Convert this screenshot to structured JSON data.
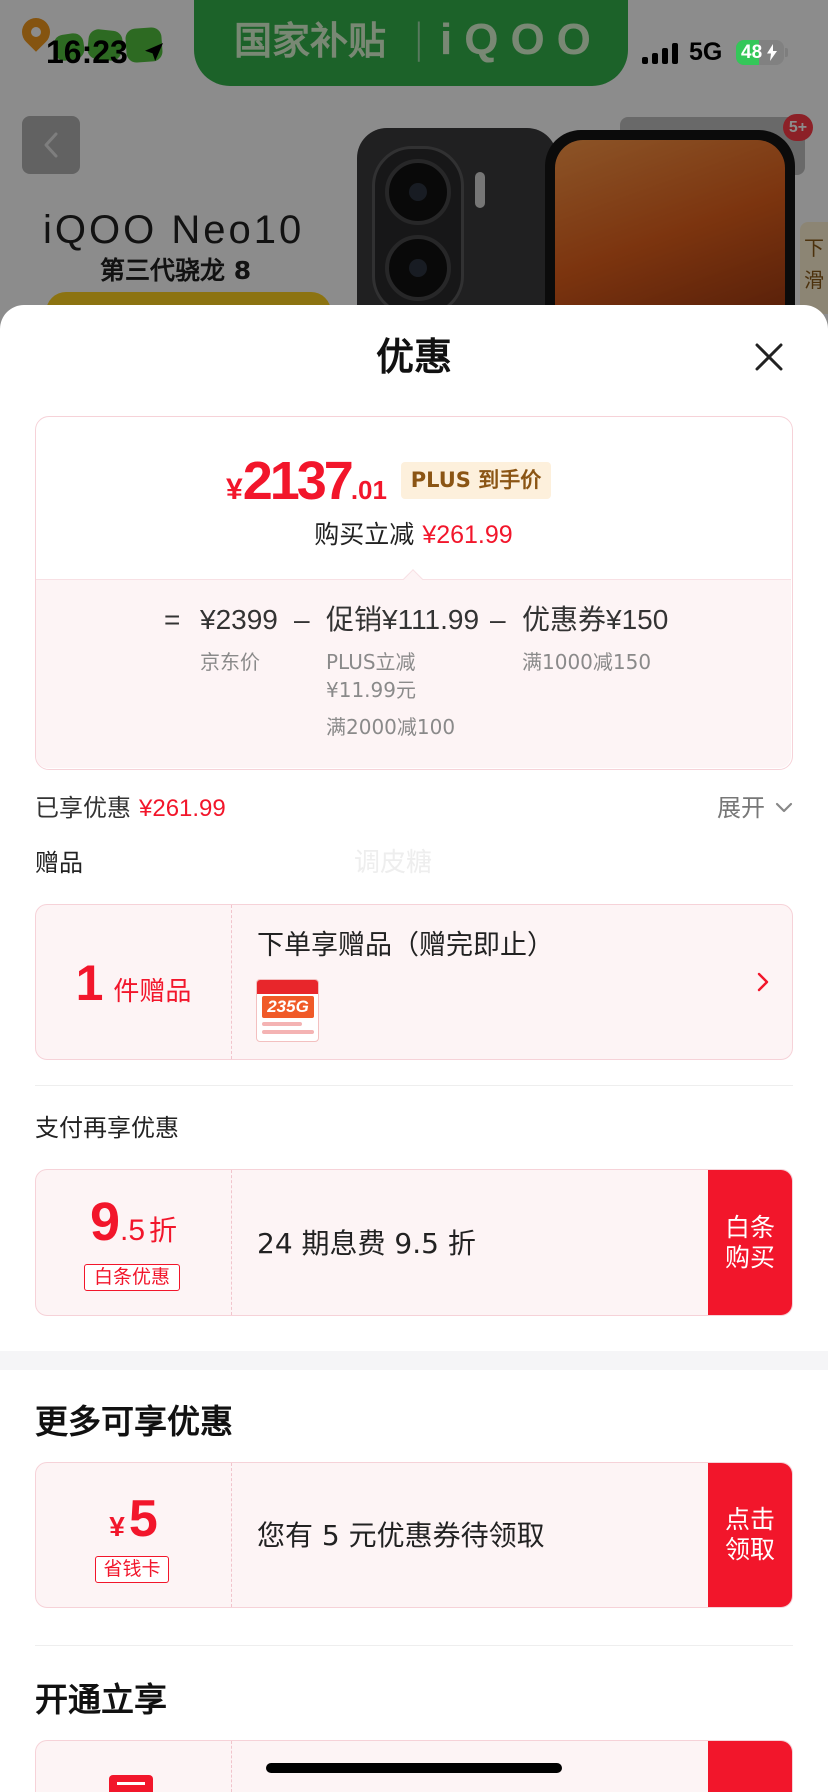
{
  "status_bar": {
    "time": "16:23",
    "network": "5G",
    "battery": "48"
  },
  "background_page": {
    "banner": {
      "left": "国家补贴",
      "divider": "|",
      "right": "iQOO"
    },
    "product": {
      "name": "iQOO Neo10",
      "chip": "第三代骁龙 8"
    },
    "side_tab": {
      "line1": "下",
      "line2": "滑"
    },
    "badge": "5+",
    "icons": [
      "chevron-left-icon",
      "star-icon",
      "share-icon",
      "more-icon"
    ]
  },
  "sheet": {
    "title": "优惠",
    "final_price": {
      "currency": "¥",
      "integer": "2137",
      "decimal": ".01",
      "badge": "PLUS 到手价"
    },
    "instant_cut": {
      "label": "购买立减",
      "amount": "¥261.99"
    },
    "breakdown": {
      "equals": "=",
      "minus": "–",
      "base": {
        "value": "¥2399",
        "note": "京东价"
      },
      "promo": {
        "value": "促销¥111.99",
        "notes": [
          "PLUS立减",
          "¥11.99元",
          "满2000减100"
        ]
      },
      "coupon": {
        "value": "优惠券¥150",
        "note": "满1000减150"
      }
    },
    "enjoyed": {
      "label": "已享优惠",
      "amount": "¥261.99",
      "toggle": "展开"
    },
    "gift_section": {
      "heading": "赠品",
      "watermark": "调皮糖",
      "count": "1",
      "unit": "件赠品",
      "title": "下单享赠品（赠完即止）",
      "thumbnail_text": "235G"
    },
    "payment_section": {
      "heading": "支付再享优惠",
      "discount_integer": "9",
      "discount_decimal": ".5",
      "discount_unit": "折",
      "tag": "白条优惠",
      "description": "24 期息费 9.5 折",
      "button": [
        "白条",
        "购买"
      ]
    },
    "more_section": {
      "heading": "更多可享优惠",
      "currency": "¥",
      "amount": "5",
      "tag": "省钱卡",
      "description": "您有 5 元优惠券待领取",
      "button": [
        "点击",
        "领取"
      ]
    },
    "membership_section": {
      "heading": "开通立享"
    }
  },
  "colors": {
    "accent": "#f2162b",
    "card_border": "#f6d2d8",
    "card_bg": "#fdf4f5",
    "badge_bg": "#fdf0dc",
    "badge_text": "#8b5514",
    "banner": "#34b34c",
    "battery": "#34c759"
  }
}
